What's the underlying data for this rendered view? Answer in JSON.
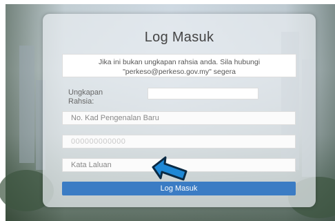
{
  "login": {
    "title": "Log Masuk",
    "notice": "Jika ini bukan ungkapan rahsia anda. Sila hubungi \"perkeso@perkeso.gov.my\" segera",
    "secret_phrase_label": "Ungkapan Rahsia:",
    "secret_phrase_value": "",
    "id_placeholder": "No. Kad Pengenalan Baru",
    "masked_value": "000000000000",
    "password_placeholder": "Kata Laluan",
    "submit_label": "Log Masuk"
  },
  "colors": {
    "button": "#3b7cc4",
    "arrow_fill": "#1e88d6",
    "arrow_stroke": "#0a2a44"
  },
  "icons": {
    "arrow": "pointer-arrow-icon"
  }
}
